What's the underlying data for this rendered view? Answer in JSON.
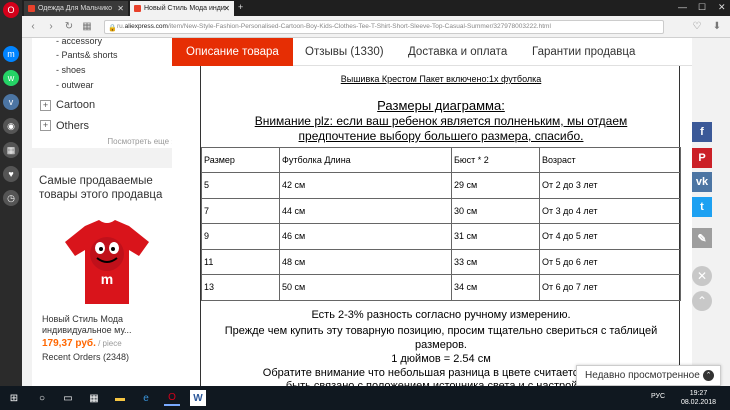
{
  "browser": {
    "tabs": [
      {
        "label": "Одежда Для Мальчико"
      },
      {
        "label": "Новый Стиль Мода инди"
      }
    ],
    "url_prefix": "ru.",
    "url_domain": "aliexpress.com",
    "url_path": "/item/New-Style-Fashion-Personalised-Cartoon-Boy-Kids-Clothes-Tee-T-Shirt-Short-Sleeve-Top-Casual-Summer/327978003222.html"
  },
  "sidebar": {
    "subcategories": [
      "- accessory",
      "- Pants& shorts",
      "- shoes",
      "- outwear"
    ],
    "categories": [
      {
        "symbol": "+",
        "label": "Cartoon"
      },
      {
        "symbol": "+",
        "label": "Others"
      }
    ],
    "see_more": "Посмотреть еще ›"
  },
  "best_sellers": {
    "title": "Самые продаваемые товары этого продавца",
    "product_name": "Новый Стиль Мода индивидуальное му...",
    "price": "179,37 руб.",
    "price_unit": " / piece",
    "orders": "Recent Orders (2348)"
  },
  "product_tabs": [
    {
      "label": "Описание товара",
      "active": true
    },
    {
      "label": "Отзывы (1330)",
      "active": false
    },
    {
      "label": "Доставка и оплата",
      "active": false
    },
    {
      "label": "Гарантии продавца",
      "active": false
    }
  ],
  "description": {
    "package_line": "Вышивка Крестом Пакет включено:1х футболка",
    "size_heading": "Размеры диаграмма:",
    "note_line1": "Внимание plz: если ваш ребенок является полненьким, мы отдаем",
    "note_line2": "предпочтение выбору большего размера, спасибо.",
    "table_header": [
      "Размер",
      "Футболка Длина",
      "Бюст * 2",
      "Возраст"
    ],
    "table_rows": [
      [
        "5",
        "42 см",
        "29 см",
        "От 2 до 3 лет"
      ],
      [
        "7",
        "44 см",
        "30 см",
        "От 3 до 4 лет"
      ],
      [
        "9",
        "46 см",
        "31 см",
        "От 4 до 5 лет"
      ],
      [
        "11",
        "48 см",
        "33 см",
        "От 5 до 6 лет"
      ],
      [
        "13",
        "50 см",
        "34 см",
        "От 6 до 7 лет"
      ]
    ],
    "measure_note": "Есть 2-3% разность согласно ручному измерению.",
    "check_note_1": "Прежде чем купить эту товарную позицию, просим тщательно свериться с таблицей",
    "check_note_2": "размеров.",
    "inch_note": "1 дюймов = 2.54 см",
    "color_note_1": "Обратите внимание что небольшая разница в цвете считается прием",
    "color_note_2": "быть связано с положением источника света и с настройкам"
  },
  "share": {
    "facebook_color": "#3b5998",
    "pinterest_color": "#cb2027",
    "vk_color": "#4c75a3",
    "twitter_color": "#1da1f2",
    "edit_color": "#9e9e9e"
  },
  "recently_viewed": {
    "label": "Недавно просмотренное"
  },
  "taskbar": {
    "lang": "РУС",
    "time": "19:27",
    "date": "08.02.2018"
  },
  "colors": {
    "accent": "#e62e04",
    "price": "#ff6600"
  }
}
